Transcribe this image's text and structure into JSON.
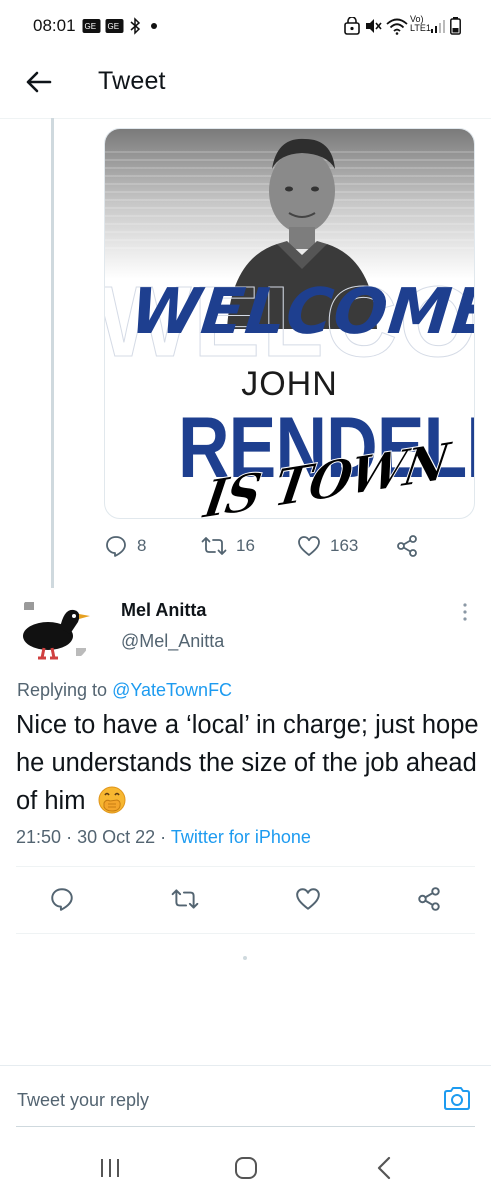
{
  "status_bar": {
    "time": "08:01",
    "network_label": "Vo) LTE1",
    "icons": [
      "app-notification-icon",
      "app-notification-icon",
      "bluetooth-icon",
      "dot-icon",
      "lock-icon",
      "mute-icon",
      "wifi-icon",
      "signal-icon",
      "battery-icon"
    ]
  },
  "header": {
    "title": "Tweet",
    "back_icon": "arrow-left-icon"
  },
  "image_card": {
    "welcome": "WELCOME",
    "first_name": "JOHN",
    "last_name": "RENDELL",
    "tagline": "IS TOWN"
  },
  "parent_actions": {
    "replies": "8",
    "retweets": "16",
    "likes": "163"
  },
  "reply_tweet": {
    "name": "Mel Anitta",
    "handle": "@Mel_Anitta",
    "replying_prefix": "Replying to",
    "replying_to": "@YateTownFC",
    "text": "Nice to have a ‘local’ in charge; just hope he understands the size of the job ahead of him",
    "emoji_icon": "face-with-hand-over-mouth-icon",
    "time": "21:50",
    "separator": "·",
    "date": "30 Oct 22",
    "source": "Twitter for iPhone"
  },
  "composer": {
    "placeholder": "Tweet your reply"
  },
  "colors": {
    "accent": "#1d9bf0",
    "text_secondary": "#536471",
    "welcome_blue": "#1e3f8f"
  }
}
